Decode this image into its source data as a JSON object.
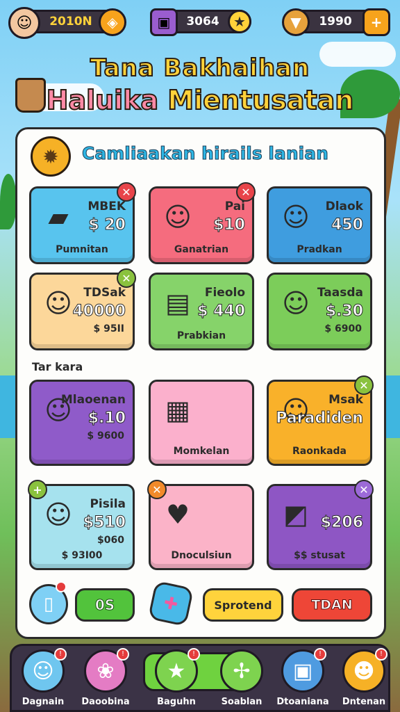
{
  "topbar": {
    "avatar_icon": "boy-avatar-icon",
    "coins_value": "2010N",
    "coins_icon": "shield-coin-icon",
    "gems_value": "3064",
    "gems_icon": "treasure-chest-icon",
    "gems_side_icon": "star-icon",
    "energy_value": "1990",
    "energy_icon": "ice-cream-icon",
    "add_icon": "plus-icon"
  },
  "title": {
    "line1": "Tana Bakhaihan",
    "line2_a": "Haluika ",
    "line2_b": "Mientusatan"
  },
  "panel": {
    "heading": "Camliaakan hirails lanian",
    "heading_icon": "sun-medal-icon",
    "section_label": "Tar kara"
  },
  "cards": [
    {
      "name": "MBEK",
      "price": "$ 20",
      "subtitle": "Pumnitan",
      "bg": "#58c4ee",
      "art": "cheese-block-icon",
      "badge": "close-icon",
      "badge_color": "#e8444a"
    },
    {
      "name": "Pai",
      "price": "$10",
      "subtitle": "Ganatrian",
      "bg": "#f56c7e",
      "art": "boy-character-icon",
      "badge": "close-icon",
      "badge_color": "#e8444a"
    },
    {
      "name": "Dlaok",
      "price": "450",
      "subtitle": "Pradkan",
      "bg": "#3f9ddf",
      "art": "boy-character-icon",
      "badge": "",
      "badge_color": ""
    },
    {
      "name": "TDSak",
      "price": "40000",
      "sub2": "$ 95II",
      "subtitle": "",
      "bg": "#fcd79a",
      "art": "boy-character-icon",
      "badge": "close-icon",
      "badge_color": "#8ac23e"
    },
    {
      "name": "Fieolo",
      "price": "$ 440",
      "subtitle": "Prabkian",
      "bg": "#86d36a",
      "art": "map-scroll-icon",
      "badge": "",
      "badge_color": ""
    },
    {
      "name": "Taasda",
      "price": "$.30",
      "sub2": "$ 6900",
      "subtitle": "",
      "bg": "#7ccd5a",
      "art": "boy-character-icon",
      "badge": "",
      "badge_color": ""
    },
    {
      "name": "Mlaoenan",
      "price": "$.10",
      "sub2": "$ 9600",
      "subtitle": "",
      "bg": "#8f5bc9",
      "art": "boy-character-icon",
      "badge": "",
      "badge_color": ""
    },
    {
      "name": "",
      "price": "",
      "subtitle": "Momkelan",
      "bg": "#fbb0cc",
      "art": "gift-cards-icon",
      "badge": "",
      "badge_color": ""
    },
    {
      "name": "Msak",
      "price": "Paradiden",
      "subtitle": "Raonkada",
      "bg": "#f9b12a",
      "art": "boy-character-icon",
      "badge": "close-icon",
      "badge_color": "#8ac23e"
    },
    {
      "name": "Pisila",
      "price": "$510",
      "sub2": "$060",
      "subtitle": "$ 93I00",
      "bg": "#a6e2ee",
      "art": "boy-character-icon",
      "badge": "plus-icon",
      "badge_color": "#8ac23e"
    },
    {
      "name": "",
      "price": "",
      "subtitle": "Dnoculsiun",
      "bg": "#fbb3c8",
      "art": "heart-icon",
      "badge": "close-icon",
      "badge_color": "#f28a2a"
    },
    {
      "name": "",
      "price": "$206",
      "subtitle": "$$ stusat",
      "bg": "#8e56c4",
      "art": "tablet-icon",
      "badge": "close-icon",
      "badge_color": "#9c6ad8"
    }
  ],
  "actions": {
    "cup_icon": "cup-icon",
    "os_label": "0S",
    "puzzle_icon": "puzzle-piece-icon",
    "sprotend_label": "Sprotend",
    "tdan_label": "TDAN"
  },
  "nav": [
    {
      "label": "Dagnain",
      "icon": "boy-avatar-icon",
      "color": "#6fc6ef"
    },
    {
      "label": "Daoobina",
      "icon": "onion-pet-icon",
      "color": "#e47cc4"
    },
    {
      "label": "Baguhn",
      "icon": "star-icon",
      "color": "#7ed34f"
    },
    {
      "label": "Soablan",
      "icon": "cross-star-icon",
      "color": "#7ed34f"
    },
    {
      "label": "Dtoaniana",
      "icon": "treasure-chest-icon",
      "color": "#4f9be0"
    },
    {
      "label": "Dntenan",
      "icon": "smiley-face-icon",
      "color": "#f6b126"
    }
  ],
  "colors": {
    "accent": "#ffd23a",
    "panel": "#fdfdfb",
    "nav": "#3b3346"
  }
}
